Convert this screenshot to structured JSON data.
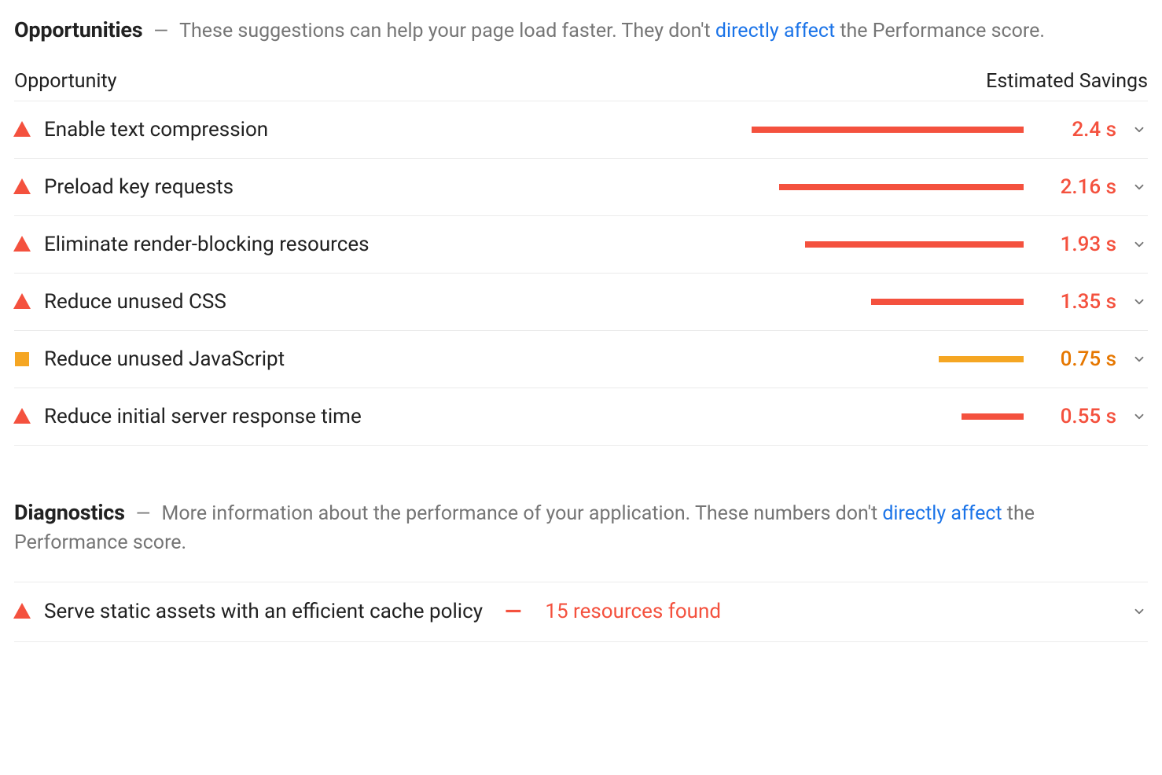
{
  "opportunities": {
    "title": "Opportunities",
    "desc_pre": "These suggestions can help your page load faster. They don't ",
    "link_text": "directly affect",
    "desc_post": " the Performance score.",
    "col_left": "Opportunity",
    "col_right": "Estimated Savings",
    "max_seconds": 2.5,
    "items": [
      {
        "label": "Enable text compression",
        "seconds": 2.4,
        "value": "2.4 s",
        "severity": "red"
      },
      {
        "label": "Preload key requests",
        "seconds": 2.16,
        "value": "2.16 s",
        "severity": "red"
      },
      {
        "label": "Eliminate render-blocking resources",
        "seconds": 1.93,
        "value": "1.93 s",
        "severity": "red"
      },
      {
        "label": "Reduce unused CSS",
        "seconds": 1.35,
        "value": "1.35 s",
        "severity": "red"
      },
      {
        "label": "Reduce unused JavaScript",
        "seconds": 0.75,
        "value": "0.75 s",
        "severity": "orange"
      },
      {
        "label": "Reduce initial server response time",
        "seconds": 0.55,
        "value": "0.55 s",
        "severity": "red"
      }
    ]
  },
  "diagnostics": {
    "title": "Diagnostics",
    "desc_pre": "More information about the performance of your application. These numbers don't ",
    "link_text": "directly affect",
    "desc_post": " the Performance score.",
    "items": [
      {
        "label": "Serve static assets with an efficient cache policy",
        "extra": "15 resources found",
        "severity": "red"
      }
    ]
  },
  "chart_data": {
    "type": "bar",
    "title": "Opportunities — Estimated Savings",
    "xlabel": "Estimated Savings (seconds)",
    "ylabel": "",
    "xlim": [
      0,
      2.5
    ],
    "categories": [
      "Enable text compression",
      "Preload key requests",
      "Eliminate render-blocking resources",
      "Reduce unused CSS",
      "Reduce unused JavaScript",
      "Reduce initial server response time"
    ],
    "values": [
      2.4,
      2.16,
      1.93,
      1.35,
      0.75,
      0.55
    ],
    "colors": [
      "#f4513e",
      "#f4513e",
      "#f4513e",
      "#f4513e",
      "#f5a623",
      "#f4513e"
    ]
  }
}
